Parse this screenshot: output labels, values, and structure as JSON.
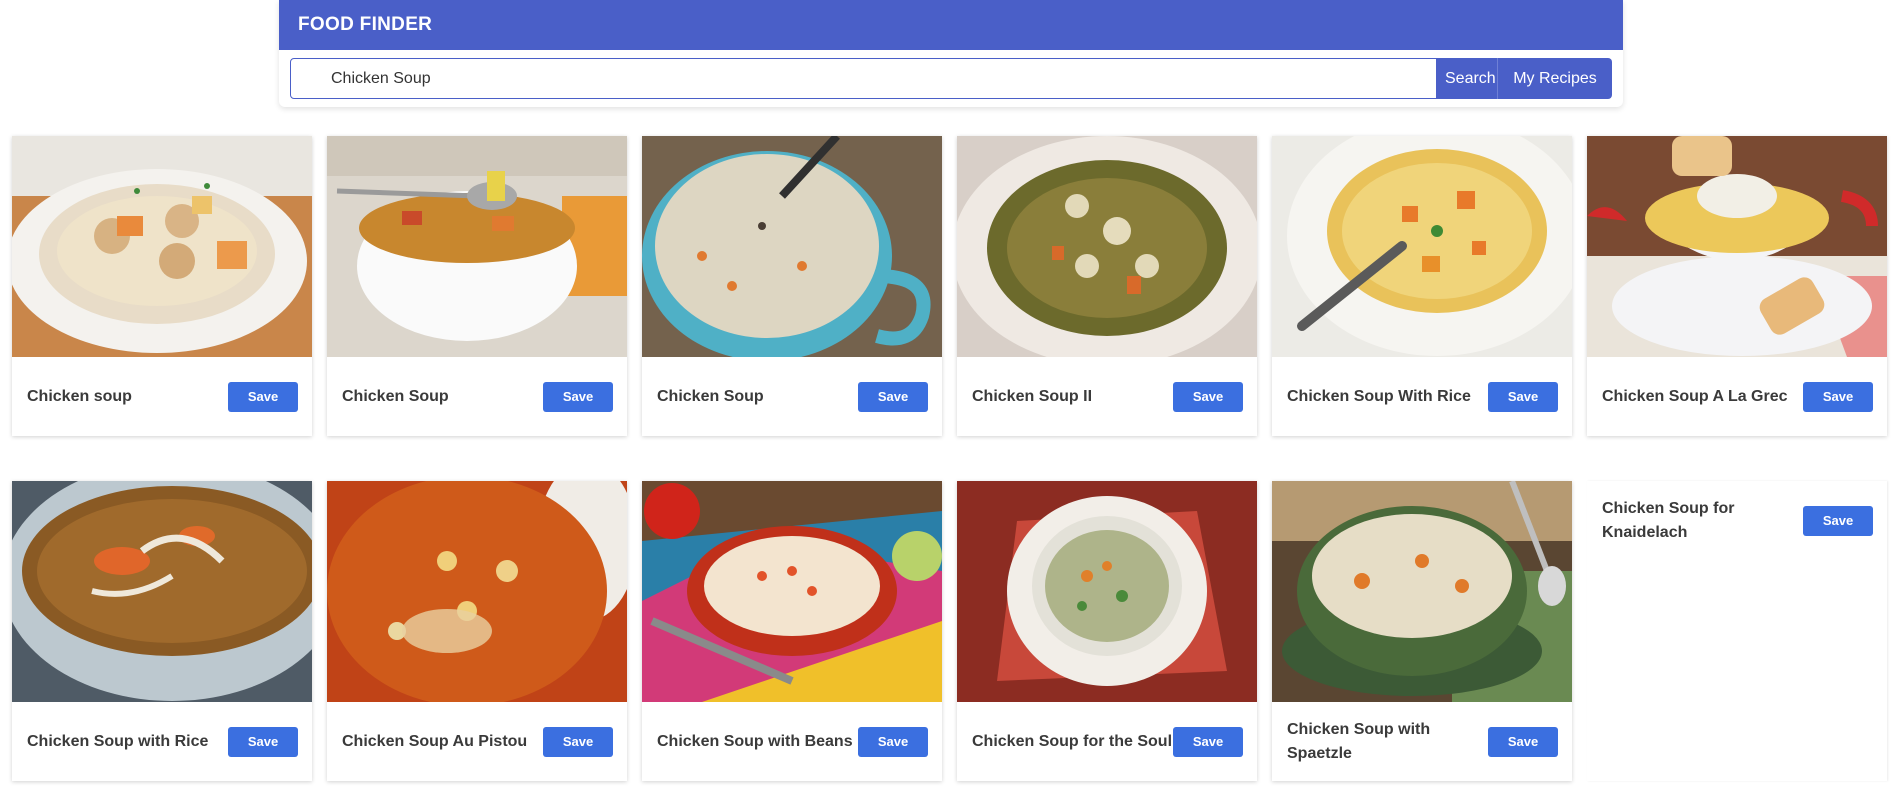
{
  "app": {
    "title": "FOOD FINDER"
  },
  "search": {
    "value": "Chicken Soup",
    "placeholder": "",
    "search_label": "Search",
    "my_recipes_label": "My Recipes"
  },
  "colors": {
    "header": "#4a5fc8",
    "save": "#3b6fe0"
  },
  "save_label": "Save",
  "recipes": [
    {
      "title": "Chicken soup",
      "image": "bowl-dumplings"
    },
    {
      "title": "Chicken Soup",
      "image": "bowl-spoon"
    },
    {
      "title": "Chicken Soup",
      "image": "mug-rice"
    },
    {
      "title": "Chicken Soup II",
      "image": "plate-gnocchi"
    },
    {
      "title": "Chicken Soup With Rice",
      "image": "bowl-rice"
    },
    {
      "title": "Chicken Soup A La Grec",
      "image": "bowl-bread"
    },
    {
      "title": "Chicken Soup with Rice",
      "image": "broth-bowl"
    },
    {
      "title": "Chicken Soup Au Pistou",
      "image": "tomato-soup"
    },
    {
      "title": "Chicken Soup with Beans",
      "image": "bean-bowl"
    },
    {
      "title": "Chicken Soup for the Soul",
      "image": "plate-veg"
    },
    {
      "title": "Chicken Soup with Spaetzle",
      "image": "green-bowl"
    },
    {
      "title": "Chicken Soup for Knaidelach",
      "image": ""
    }
  ]
}
